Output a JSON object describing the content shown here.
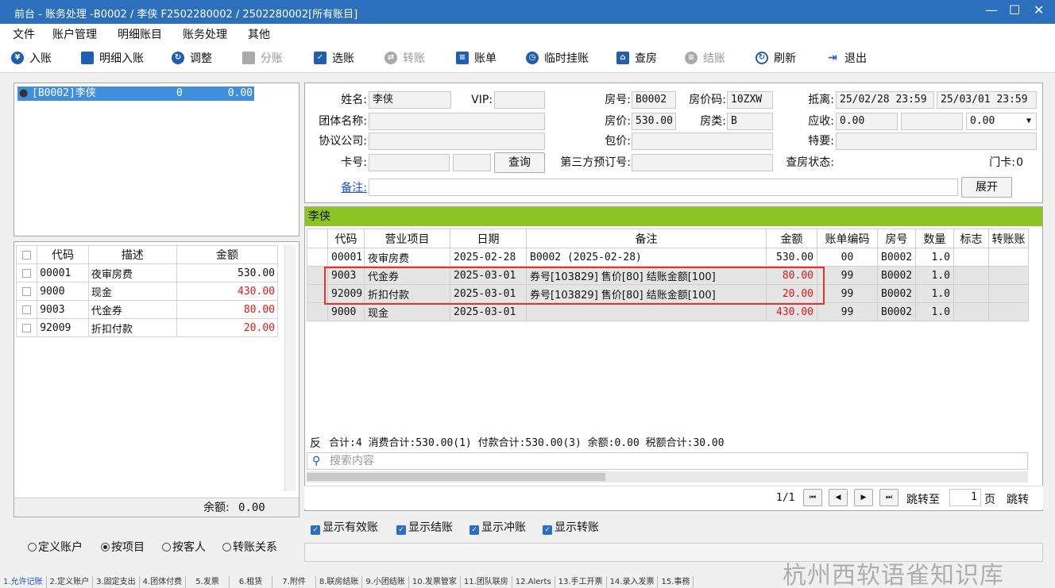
{
  "window": {
    "title": "前台 - 账务处理 -B0002 / 李侠  F2502280002 / 2502280002[所有账目]"
  },
  "menu": [
    "文件",
    "账户管理",
    "明细账目",
    "账务处理",
    "其他"
  ],
  "toolbar": {
    "post": "入账",
    "detail_post": "明细入账",
    "adjust": "调整",
    "split": "分账",
    "select": "选账",
    "transfer": "转账",
    "bill": "账单",
    "temp_hang": "临时挂账",
    "check_room": "查房",
    "checkout": "结账",
    "refresh": "刷新",
    "exit": "退出"
  },
  "tree": {
    "item": "[B0002]李侠",
    "count": "0",
    "amount": "0.00"
  },
  "left_table": {
    "headers": [
      "代码",
      "描述",
      "金额"
    ],
    "rows": [
      {
        "code": "00001",
        "desc": "夜审房费",
        "amount": "530.00"
      },
      {
        "code": "9000",
        "desc": "现金",
        "amount": "430.00"
      },
      {
        "code": "9003",
        "desc": "代金券",
        "amount": "80.00"
      },
      {
        "code": "92009",
        "desc": "折扣付款",
        "amount": "20.00"
      }
    ],
    "balance_label": "余额:",
    "balance_value": "0.00"
  },
  "view_options": {
    "custom": "定义账户",
    "by_item": "按项目",
    "by_guest": "按客人",
    "transfer_rel": "转账关系"
  },
  "guest": {
    "name_label": "姓名:",
    "name": "李侠",
    "vip_label": "VIP:",
    "vip": "",
    "room_label": "房号:",
    "room": "B0002",
    "rate_code_label": "房价码:",
    "rate_code": "10ZXW",
    "arrdep_label": "抵离:",
    "arrival": "25/02/28 23:59",
    "departure": "25/03/01 23:59",
    "group_label": "团体名称:",
    "group": "",
    "rate_label": "房价:",
    "rate": "530.00",
    "room_type_label": "房类:",
    "room_type": "B",
    "receivable_label": "应收:",
    "receivable": "0.00",
    "receivable_sel": "0.00",
    "company_label": "协议公司:",
    "company": "",
    "package_label": "包价:",
    "package": "",
    "special_label": "特要:",
    "special": "",
    "card_label": "卡号:",
    "card": "",
    "query_button": "查询",
    "third_party_label": "第三方预订号:",
    "third_party": "",
    "check_status_label": "查房状态:",
    "check_status": "",
    "door_card_label": "门卡:",
    "door_card": "0",
    "remark_label": "备注:",
    "remark": "",
    "expand_button": "展开"
  },
  "grid": {
    "guest_header": "李侠",
    "headers": [
      "代码",
      "营业项目",
      "日期",
      "备注",
      "金额",
      "账单编码",
      "房号",
      "数量",
      "标志",
      "转账账"
    ],
    "rows": [
      {
        "code": "00001",
        "item": "夜审房费",
        "date": "2025-02-28",
        "remark": "B0002 (2025-02-28)",
        "amount": "530.00",
        "bill": "00",
        "room": "B0002",
        "qty": "1.0",
        "flag": "",
        "trans": ""
      },
      {
        "code": "9003",
        "item": "代金券",
        "date": "2025-03-01",
        "remark": "券号[103829] 售价[80] 结账金额[100]",
        "amount": "80.00",
        "bill": "99",
        "room": "B0002",
        "qty": "1.0",
        "flag": "",
        "trans": ""
      },
      {
        "code": "92009",
        "item": "折扣付款",
        "date": "2025-03-01",
        "remark": "券号[103829] 售价[80] 结账金额[100]",
        "amount": "20.00",
        "bill": "99",
        "room": "B0002",
        "qty": "1.0",
        "flag": "",
        "trans": ""
      },
      {
        "code": "9000",
        "item": "现金",
        "date": "2025-03-01",
        "remark": "",
        "amount": "430.00",
        "bill": "99",
        "room": "B0002",
        "qty": "1.0",
        "flag": "",
        "trans": ""
      }
    ],
    "reverse_label": "反",
    "summary": "合计:4  消费合计:530.00(1)  付款合计:530.00(3)  余额:0.00  税额合计:30.00",
    "search_placeholder": "搜索内容"
  },
  "pager": {
    "page": "1/1",
    "jump_label": "跳转至",
    "jump_value": "1",
    "page_unit": "页",
    "go": "跳转"
  },
  "filters": {
    "valid": "显示有效账",
    "settled": "显示结账",
    "reversed": "显示冲账",
    "transfer": "显示转账"
  },
  "bottom_tabs": [
    "1.允许记账",
    "2.定义账户",
    "3.固定支出",
    "4.团体付费",
    "5.发票",
    "6.租赁",
    "7.附件",
    "8.联房结账",
    "9.小团结账",
    "10.发票管家",
    "11.团队联房",
    "12.Alerts",
    "13.手工开票",
    "14.录入发票",
    "15.事務"
  ],
  "watermark": "杭州西软语雀知识库",
  "colors": {
    "titlebar": "#2c6fbd",
    "guest_bar": "#8cc522",
    "highlight_box": "#e8302a",
    "amount_red": "#e21818"
  }
}
